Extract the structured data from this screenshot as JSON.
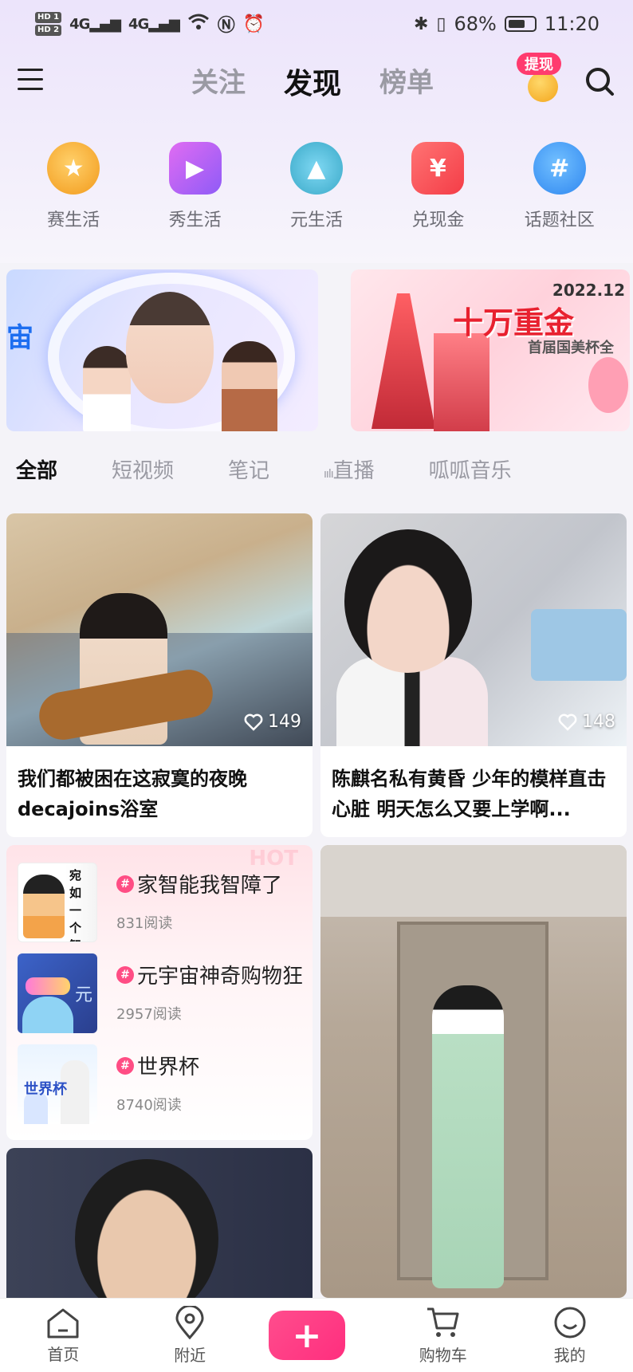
{
  "status_bar": {
    "hd1": "HD 1",
    "hd2": "HD 2",
    "network1": "4G",
    "network2": "4G",
    "battery": "68%",
    "time": "11:20"
  },
  "header": {
    "tabs": [
      {
        "label": "关注"
      },
      {
        "label": "发现"
      },
      {
        "label": "榜单"
      }
    ],
    "active_tab": "发现",
    "withdraw_badge": "提现"
  },
  "quick_entries": [
    {
      "label": "赛生活",
      "icon": "medal-icon"
    },
    {
      "label": "秀生活",
      "icon": "video-camera-icon"
    },
    {
      "label": "元生活",
      "icon": "metaverse-city-icon"
    },
    {
      "label": "兑现金",
      "icon": "red-packet-icon"
    },
    {
      "label": "话题社区",
      "icon": "hashtag-bubble-icon"
    }
  ],
  "banners": {
    "left_edge_text": "宙",
    "right_date": "2022.12",
    "right_headline": "十万重金",
    "right_sub": "首届国美杯全"
  },
  "category_tabs": [
    {
      "label": "全部"
    },
    {
      "label": "短视频"
    },
    {
      "label": "笔记"
    },
    {
      "label": "直播"
    },
    {
      "label": "呱呱音乐"
    }
  ],
  "feed": {
    "card1": {
      "title": "我们都被困在这寂寞的夜晚decajoins浴室",
      "likes": "149"
    },
    "card2": {
      "title": "陈麒名私有黄昏 少年的模样直击心脏 明天怎么又要上学啊...",
      "likes": "148"
    },
    "topic_card": {
      "watermark": "HOT",
      "topics": [
        {
          "name": "家智能我智障了",
          "reads": "831阅读",
          "thumb_text": "宛如一个智障"
        },
        {
          "name": "元宇宙神奇购物狂",
          "reads": "2957阅读",
          "thumb_text": "元"
        },
        {
          "name": "世界杯",
          "reads": "8740阅读",
          "thumb_text": "世界杯"
        }
      ]
    }
  },
  "bottom_nav": [
    {
      "label": "首页"
    },
    {
      "label": "附近"
    },
    {
      "label": "+"
    },
    {
      "label": "购物车"
    },
    {
      "label": "我的"
    }
  ],
  "colors": {
    "accent": "#ff2e7e",
    "badge": "#ff3b6e",
    "text_primary": "#111111",
    "text_muted": "#9a9aa3"
  }
}
